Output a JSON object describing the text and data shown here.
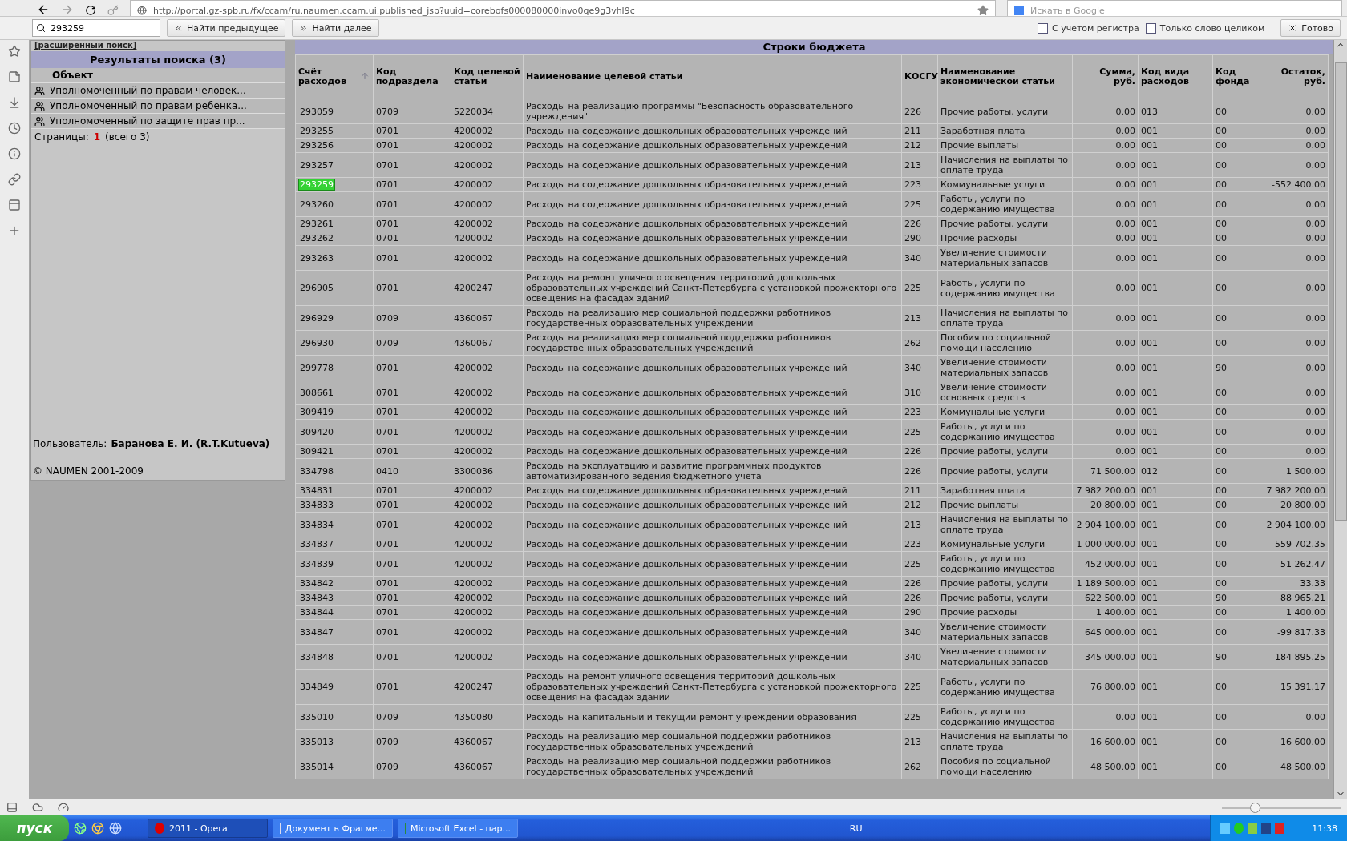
{
  "browser": {
    "url": "http://portal.gz-spb.ru/fx/ccam/ru.naumen.ccam.ui.published_jsp?uuid=corebofs000080000invo0qe9g3vhl9c",
    "search_placeholder": "Искать в Google"
  },
  "find_bar": {
    "query": "293259",
    "prev_button": "Найти предыдущее",
    "next_button": "Найти далее",
    "options": [
      {
        "label": "С учетом регистра",
        "checked": false
      },
      {
        "label": "Только слово целиком",
        "checked": false
      }
    ],
    "done_button": "Готово"
  },
  "left_panel": {
    "advanced_link": "[расширенный поиск]",
    "title": "Результаты поиска (3)",
    "column": "Объект",
    "results": [
      {
        "label": "Уполномоченный по правам человек..."
      },
      {
        "label": "Уполномоченный по правам ребенка..."
      },
      {
        "label": "Уполномоченный по защите прав пр..."
      }
    ],
    "pages_label": "Страницы:",
    "current_page": "1",
    "pages_total": "(всего 3)",
    "user_label": "Пользователь:",
    "user_name": "Баранова Е. И. (R.T.Kutueva)",
    "copyright": "© NAUMEN 2001-2009"
  },
  "table": {
    "title": "Строки бюджета",
    "columns": [
      {
        "label": "Счёт расходов",
        "sorted": true
      },
      {
        "label": "Код подраздела",
        "sorted": false
      },
      {
        "label": "Код целевой статьи",
        "sorted": false
      },
      {
        "label": "Наименование целевой статьи",
        "sorted": false
      },
      {
        "label": "КОСГУ",
        "sorted": false
      },
      {
        "label": "Наименование экономической статьи",
        "sorted": false
      },
      {
        "label": "Сумма, руб.",
        "sorted": false
      },
      {
        "label": "Код вида расходов",
        "sorted": false
      },
      {
        "label": "Код фонда",
        "sorted": false
      },
      {
        "label": "Остаток, руб.",
        "sorted": false
      }
    ],
    "rows": [
      {
        "highlighted": false,
        "cells": [
          "293059",
          "0709",
          "5220034",
          "Расходы на реализацию программы \"Безопасность образовательного учреждения\"",
          "226",
          "Прочие работы, услуги",
          "0.00",
          "013",
          "00",
          "0.00"
        ]
      },
      {
        "highlighted": false,
        "cells": [
          "293255",
          "0701",
          "4200002",
          "Расходы на содержание дошкольных образовательных учреждений",
          "211",
          "Заработная плата",
          "0.00",
          "001",
          "00",
          "0.00"
        ]
      },
      {
        "highlighted": false,
        "cells": [
          "293256",
          "0701",
          "4200002",
          "Расходы на содержание дошкольных образовательных учреждений",
          "212",
          "Прочие выплаты",
          "0.00",
          "001",
          "00",
          "0.00"
        ]
      },
      {
        "highlighted": false,
        "cells": [
          "293257",
          "0701",
          "4200002",
          "Расходы на содержание дошкольных образовательных учреждений",
          "213",
          "Начисления на выплаты по оплате труда",
          "0.00",
          "001",
          "00",
          "0.00"
        ]
      },
      {
        "highlighted": true,
        "cells": [
          "293259",
          "0701",
          "4200002",
          "Расходы на содержание дошкольных образовательных учреждений",
          "223",
          "Коммунальные услуги",
          "0.00",
          "001",
          "00",
          "-552 400.00"
        ]
      },
      {
        "highlighted": false,
        "cells": [
          "293260",
          "0701",
          "4200002",
          "Расходы на содержание дошкольных образовательных учреждений",
          "225",
          "Работы, услуги по содержанию имущества",
          "0.00",
          "001",
          "00",
          "0.00"
        ]
      },
      {
        "highlighted": false,
        "cells": [
          "293261",
          "0701",
          "4200002",
          "Расходы на содержание дошкольных образовательных учреждений",
          "226",
          "Прочие работы, услуги",
          "0.00",
          "001",
          "00",
          "0.00"
        ]
      },
      {
        "highlighted": false,
        "cells": [
          "293262",
          "0701",
          "4200002",
          "Расходы на содержание дошкольных образовательных учреждений",
          "290",
          "Прочие расходы",
          "0.00",
          "001",
          "00",
          "0.00"
        ]
      },
      {
        "highlighted": false,
        "cells": [
          "293263",
          "0701",
          "4200002",
          "Расходы на содержание дошкольных образовательных учреждений",
          "340",
          "Увеличение стоимости материальных запасов",
          "0.00",
          "001",
          "00",
          "0.00"
        ]
      },
      {
        "highlighted": false,
        "cells": [
          "296905",
          "0701",
          "4200247",
          "Расходы на ремонт уличного освещения территорий дошкольных образовательных учреждений Санкт-Петербурга с установкой прожекторного освещения на фасадах зданий",
          "225",
          "Работы, услуги по содержанию имущества",
          "0.00",
          "001",
          "00",
          "0.00"
        ]
      },
      {
        "highlighted": false,
        "cells": [
          "296929",
          "0709",
          "4360067",
          "Расходы на реализацию мер социальной поддержки работников государственных образовательных учреждений",
          "213",
          "Начисления на выплаты по оплате труда",
          "0.00",
          "001",
          "00",
          "0.00"
        ]
      },
      {
        "highlighted": false,
        "cells": [
          "296930",
          "0709",
          "4360067",
          "Расходы на реализацию мер социальной поддержки работников государственных образовательных учреждений",
          "262",
          "Пособия по социальной помощи населению",
          "0.00",
          "001",
          "00",
          "0.00"
        ]
      },
      {
        "highlighted": false,
        "cells": [
          "299778",
          "0701",
          "4200002",
          "Расходы на содержание дошкольных образовательных учреждений",
          "340",
          "Увеличение стоимости материальных запасов",
          "0.00",
          "001",
          "90",
          "0.00"
        ]
      },
      {
        "highlighted": false,
        "cells": [
          "308661",
          "0701",
          "4200002",
          "Расходы на содержание дошкольных образовательных учреждений",
          "310",
          "Увеличение стоимости основных средств",
          "0.00",
          "001",
          "00",
          "0.00"
        ]
      },
      {
        "highlighted": false,
        "cells": [
          "309419",
          "0701",
          "4200002",
          "Расходы на содержание дошкольных образовательных учреждений",
          "223",
          "Коммунальные услуги",
          "0.00",
          "001",
          "00",
          "0.00"
        ]
      },
      {
        "highlighted": false,
        "cells": [
          "309420",
          "0701",
          "4200002",
          "Расходы на содержание дошкольных образовательных учреждений",
          "225",
          "Работы, услуги по содержанию имущества",
          "0.00",
          "001",
          "00",
          "0.00"
        ]
      },
      {
        "highlighted": false,
        "cells": [
          "309421",
          "0701",
          "4200002",
          "Расходы на содержание дошкольных образовательных учреждений",
          "226",
          "Прочие работы, услуги",
          "0.00",
          "001",
          "00",
          "0.00"
        ]
      },
      {
        "highlighted": false,
        "cells": [
          "334798",
          "0410",
          "3300036",
          "Расходы на эксплуатацию и развитие программных продуктов автоматизированного ведения бюджетного учета",
          "226",
          "Прочие работы, услуги",
          "71 500.00",
          "012",
          "00",
          "1 500.00"
        ]
      },
      {
        "highlighted": false,
        "cells": [
          "334831",
          "0701",
          "4200002",
          "Расходы на содержание дошкольных образовательных учреждений",
          "211",
          "Заработная плата",
          "7 982 200.00",
          "001",
          "00",
          "7 982 200.00"
        ]
      },
      {
        "highlighted": false,
        "cells": [
          "334833",
          "0701",
          "4200002",
          "Расходы на содержание дошкольных образовательных учреждений",
          "212",
          "Прочие выплаты",
          "20 800.00",
          "001",
          "00",
          "20 800.00"
        ]
      },
      {
        "highlighted": false,
        "cells": [
          "334834",
          "0701",
          "4200002",
          "Расходы на содержание дошкольных образовательных учреждений",
          "213",
          "Начисления на выплаты по оплате труда",
          "2 904 100.00",
          "001",
          "00",
          "2 904 100.00"
        ]
      },
      {
        "highlighted": false,
        "cells": [
          "334837",
          "0701",
          "4200002",
          "Расходы на содержание дошкольных образовательных учреждений",
          "223",
          "Коммунальные услуги",
          "1 000 000.00",
          "001",
          "00",
          "559 702.35"
        ]
      },
      {
        "highlighted": false,
        "cells": [
          "334839",
          "0701",
          "4200002",
          "Расходы на содержание дошкольных образовательных учреждений",
          "225",
          "Работы, услуги по содержанию имущества",
          "452 000.00",
          "001",
          "00",
          "51 262.47"
        ]
      },
      {
        "highlighted": false,
        "cells": [
          "334842",
          "0701",
          "4200002",
          "Расходы на содержание дошкольных образовательных учреждений",
          "226",
          "Прочие работы, услуги",
          "1 189 500.00",
          "001",
          "00",
          "33.33"
        ]
      },
      {
        "highlighted": false,
        "cells": [
          "334843",
          "0701",
          "4200002",
          "Расходы на содержание дошкольных образовательных учреждений",
          "226",
          "Прочие работы, услуги",
          "622 500.00",
          "001",
          "90",
          "88 965.21"
        ]
      },
      {
        "highlighted": false,
        "cells": [
          "334844",
          "0701",
          "4200002",
          "Расходы на содержание дошкольных образовательных учреждений",
          "290",
          "Прочие расходы",
          "1 400.00",
          "001",
          "00",
          "1 400.00"
        ]
      },
      {
        "highlighted": false,
        "cells": [
          "334847",
          "0701",
          "4200002",
          "Расходы на содержание дошкольных образовательных учреждений",
          "340",
          "Увеличение стоимости материальных запасов",
          "645 000.00",
          "001",
          "00",
          "-99 817.33"
        ]
      },
      {
        "highlighted": false,
        "cells": [
          "334848",
          "0701",
          "4200002",
          "Расходы на содержание дошкольных образовательных учреждений",
          "340",
          "Увеличение стоимости материальных запасов",
          "345 000.00",
          "001",
          "90",
          "184 895.25"
        ]
      },
      {
        "highlighted": false,
        "cells": [
          "334849",
          "0701",
          "4200247",
          "Расходы на ремонт уличного освещения территорий дошкольных образовательных учреждений Санкт-Петербурга с установкой прожекторного освещения на фасадах зданий",
          "225",
          "Работы, услуги по содержанию имущества",
          "76 800.00",
          "001",
          "00",
          "15 391.17"
        ]
      },
      {
        "highlighted": false,
        "cells": [
          "335010",
          "0709",
          "4350080",
          "Расходы на капитальный и текущий ремонт учреждений образования",
          "225",
          "Работы, услуги по содержанию имущества",
          "0.00",
          "001",
          "00",
          "0.00"
        ]
      },
      {
        "highlighted": false,
        "cells": [
          "335013",
          "0709",
          "4360067",
          "Расходы на реализацию мер социальной поддержки работников государственных образовательных учреждений",
          "213",
          "Начисления на выплаты по оплате труда",
          "16 600.00",
          "001",
          "00",
          "16 600.00"
        ]
      },
      {
        "highlighted": false,
        "cells": [
          "335014",
          "0709",
          "4360067",
          "Расходы на реализацию мер социальной поддержки работников государственных образовательных учреждений",
          "262",
          "Пособия по социальной помощи населению",
          "48 500.00",
          "001",
          "00",
          "48 500.00"
        ]
      }
    ]
  },
  "status_bar": {
    "zoom": {
      "level": 0.28
    }
  },
  "taskbar": {
    "start": "пуск",
    "tasks": [
      {
        "label": "2011 - Opera",
        "selected": true,
        "kind": "opera"
      },
      {
        "label": "Документ в Фрагме...",
        "selected": false,
        "kind": "word"
      },
      {
        "label": "Microsoft Excel - пар...",
        "selected": false,
        "kind": "excel"
      }
    ],
    "language": "RU",
    "clock": "11:38"
  }
}
